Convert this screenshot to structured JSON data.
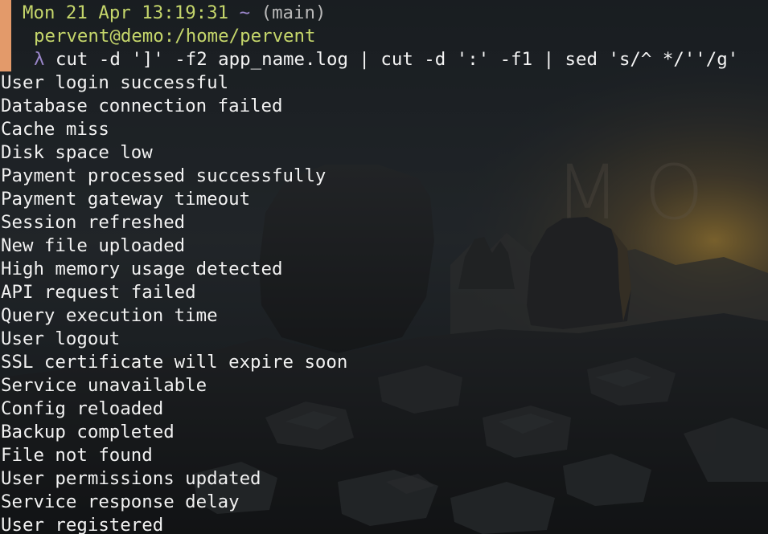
{
  "prompt": {
    "datetime": "Mon 21 Apr 13:19:31",
    "tilde": "~",
    "branch": "(main)",
    "user_host_path": "pervent@demo:/home/pervent",
    "lambda": "λ",
    "command": "cut -d ']' -f2 app_name.log | cut -d ':' -f1 | sed 's/^ */''/g'"
  },
  "wallpaper": {
    "watermark_text": "MO"
  },
  "output": [
    "User login successful",
    "Database connection failed",
    "Cache miss",
    "Disk space low",
    "Payment processed successfully",
    "Payment gateway timeout",
    "Session refreshed",
    "New file uploaded",
    "High memory usage detected",
    "API request failed",
    "Query execution time",
    "User logout",
    "SSL certificate will expire soon",
    "Service unavailable",
    "Config reloaded",
    "Backup completed",
    "File not found",
    "User permissions updated",
    "Service response delay",
    "User registered"
  ],
  "colors": {
    "accent_bar": "#e39a6a",
    "prompt_green": "#c5d66b",
    "prompt_purple": "#9a86c9",
    "text": "#f2f2f2"
  }
}
